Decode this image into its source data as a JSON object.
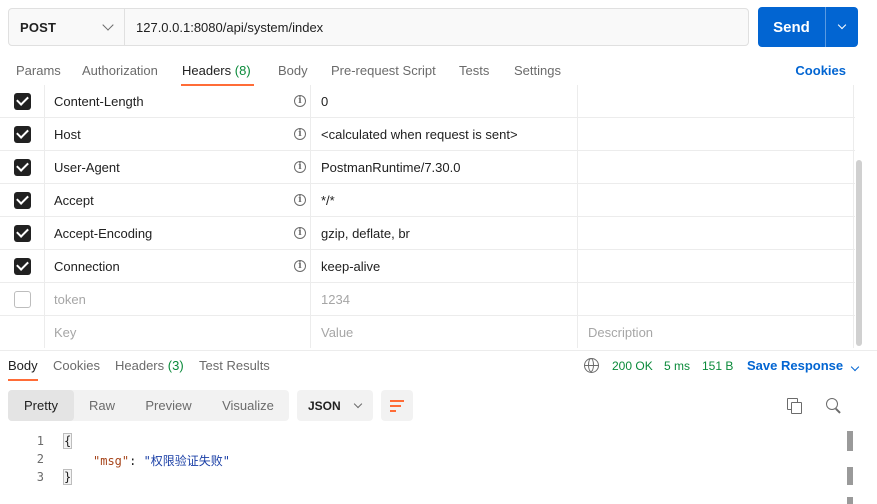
{
  "request": {
    "method": "POST",
    "url": "127.0.0.1:8080/api/system/index",
    "send_label": "Send"
  },
  "request_tabs": [
    {
      "label": "Params",
      "count": ""
    },
    {
      "label": "Authorization",
      "count": ""
    },
    {
      "label": "Headers",
      "count": "(8)"
    },
    {
      "label": "Body",
      "count": ""
    },
    {
      "label": "Pre-request Script",
      "count": ""
    },
    {
      "label": "Tests",
      "count": ""
    },
    {
      "label": "Settings",
      "count": ""
    }
  ],
  "active_request_tab": "Headers",
  "cookies_label": "Cookies",
  "headers": [
    {
      "key": "Content-Length",
      "value": "0",
      "checked": true,
      "info": true
    },
    {
      "key": "Host",
      "value": "<calculated when request is sent>",
      "checked": true,
      "info": true
    },
    {
      "key": "User-Agent",
      "value": "PostmanRuntime/7.30.0",
      "checked": true,
      "info": true
    },
    {
      "key": "Accept",
      "value": "*/*",
      "checked": true,
      "info": true
    },
    {
      "key": "Accept-Encoding",
      "value": "gzip, deflate, br",
      "checked": true,
      "info": true
    },
    {
      "key": "Connection",
      "value": "keep-alive",
      "checked": true,
      "info": true
    },
    {
      "key": "token",
      "value": "1234",
      "checked": false,
      "info": false
    }
  ],
  "new_header_placeholders": {
    "key": "Key",
    "value": "Value",
    "description": "Description"
  },
  "response_tabs": [
    {
      "label": "Body",
      "count": ""
    },
    {
      "label": "Cookies",
      "count": ""
    },
    {
      "label": "Headers",
      "count": "(3)"
    },
    {
      "label": "Test Results",
      "count": ""
    }
  ],
  "active_response_tab": "Body",
  "response_status": {
    "status": "200 OK",
    "time": "5 ms",
    "size": "151 B"
  },
  "save_response_label": "Save Response",
  "view_modes": [
    "Pretty",
    "Raw",
    "Preview",
    "Visualize"
  ],
  "active_view_mode": "Pretty",
  "format": "JSON",
  "code_lines": [
    {
      "n": "1",
      "text": "{"
    },
    {
      "n": "2",
      "key": "\"msg\"",
      "sep": ": ",
      "value": "\"权限验证失败\""
    },
    {
      "n": "3",
      "text": "}"
    }
  ],
  "colors": {
    "accent": "#0265d2",
    "tab_indicator": "#ff6c37",
    "status_ok": "#0a8a3a"
  },
  "icons": [
    "chevron-down-icon",
    "info-icon",
    "checkbox-icon",
    "globe-icon",
    "wrap-lines-icon",
    "copy-icon",
    "search-icon"
  ]
}
